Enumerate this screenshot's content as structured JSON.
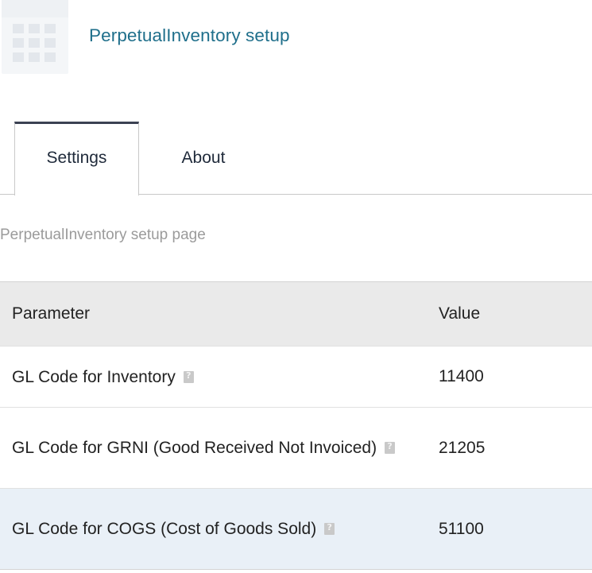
{
  "header": {
    "title": "PerpetualInventory setup",
    "icon": "calculator-icon"
  },
  "tabs": [
    {
      "label": "Settings",
      "active": true
    },
    {
      "label": "About",
      "active": false
    }
  ],
  "page": {
    "subtitle": "PerpetualInventory setup page"
  },
  "table": {
    "headers": [
      "Parameter",
      "Value"
    ],
    "rows": [
      {
        "parameter": "GL Code for Inventory",
        "value": "11400",
        "help": "help-icon"
      },
      {
        "parameter": "GL Code for GRNI (Good Received Not Invoiced)",
        "value": "21205",
        "help": "help-icon"
      },
      {
        "parameter": "GL Code for COGS (Cost of Goods Sold)",
        "value": "51100",
        "help": "help-icon",
        "highlighted": true
      }
    ]
  },
  "colors": {
    "title": "#1f6f8b",
    "header_row_bg": "#eaeaea",
    "highlight_row_bg": "#e9f0f7",
    "active_tab_border": "#3b4152",
    "subtitle": "#9b9b9b"
  }
}
